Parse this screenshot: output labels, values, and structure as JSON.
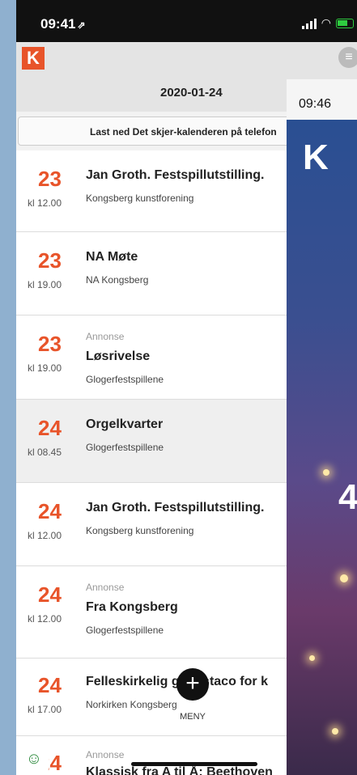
{
  "status": {
    "time": "09:41",
    "arrow": "⇗"
  },
  "header": {
    "logo": "K",
    "date": "2020-01-24",
    "menu_icon": "≡"
  },
  "download": {
    "label": "Last ned Det skjer-kalenderen på telefon"
  },
  "events": [
    {
      "day": "23",
      "time": "kl 12.00",
      "ad": "",
      "title": "Jan Groth. Festspillutstilling.",
      "venue": "Kongsberg kunstforening"
    },
    {
      "day": "23",
      "time": "kl 19.00",
      "ad": "",
      "title": "NA Møte",
      "venue": "NA Kongsberg"
    },
    {
      "day": "23",
      "time": "kl 19.00",
      "ad": "Annonse",
      "title": "Løsrivelse",
      "venue": "Glogerfestspillene"
    },
    {
      "day": "24",
      "time": "kl 08.45",
      "ad": "",
      "title": "Orgelkvarter",
      "venue": "Glogerfestspillene"
    },
    {
      "day": "24",
      "time": "kl 12.00",
      "ad": "",
      "title": "Jan Groth. Festspillutstilling.",
      "venue": "Kongsberg kunstforening"
    },
    {
      "day": "24",
      "time": "kl 12.00",
      "ad": "Annonse",
      "title": "Fra Kongsberg",
      "venue": "Glogerfestspillene"
    },
    {
      "day": "24",
      "time": "kl 17.00",
      "ad": "",
      "title": "Felleskirkelig gangstaco for k",
      "venue": "Norkirken Kongsberg"
    },
    {
      "day": "24",
      "time": "",
      "ad": "Annonse",
      "title": "Klassisk fra A til Å: Beethoven",
      "venue": ""
    }
  ],
  "fab": {
    "plus": "+",
    "label": "MENY"
  },
  "overlay": {
    "time": "09:46",
    "logo": "K",
    "number": "4"
  },
  "badge": {
    "icon": "☺"
  },
  "colors": {
    "accent": "#e8542a",
    "status_bar": "#111111",
    "battery": "#2ecc40"
  }
}
